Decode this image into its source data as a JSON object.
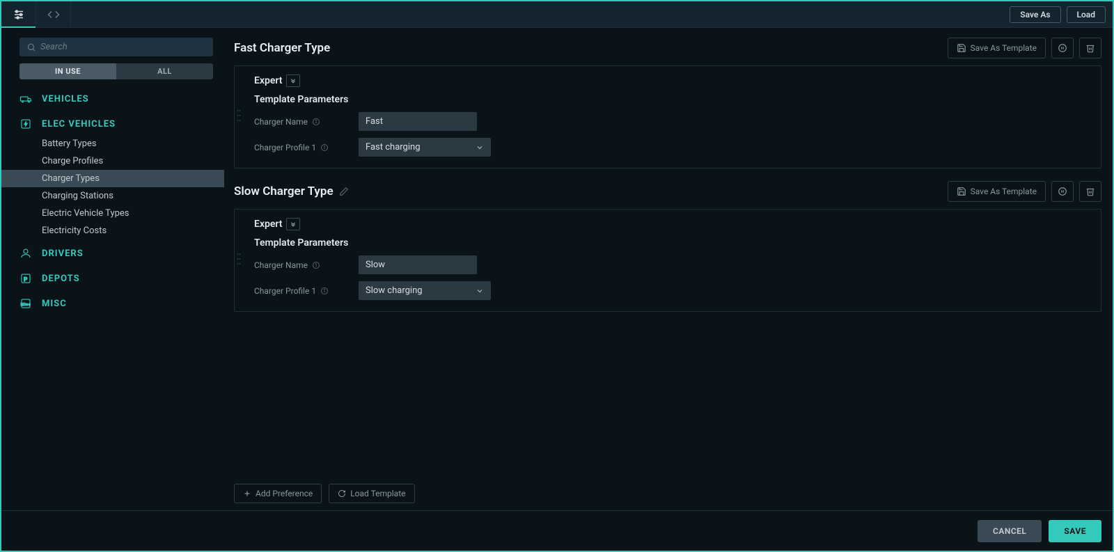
{
  "topbar": {
    "save_as": "Save As",
    "load": "Load"
  },
  "sidebar": {
    "search_placeholder": "Search",
    "filter": {
      "in_use": "IN USE",
      "all": "ALL"
    },
    "sections": [
      {
        "label": "VEHICLES",
        "items": []
      },
      {
        "label": "ELEC VEHICLES",
        "items": [
          {
            "label": "Battery Types"
          },
          {
            "label": "Charge Profiles"
          },
          {
            "label": "Charger Types",
            "active": true
          },
          {
            "label": "Charging Stations"
          },
          {
            "label": "Electric Vehicle Types"
          },
          {
            "label": "Electricity Costs"
          }
        ]
      },
      {
        "label": "DRIVERS",
        "items": []
      },
      {
        "label": "DEPOTS",
        "items": []
      },
      {
        "label": "MISC",
        "items": []
      }
    ]
  },
  "content": {
    "save_as_template": "Save As Template",
    "sections": [
      {
        "title": "Fast Charger Type",
        "editable": false,
        "expert_label": "Expert",
        "subsection": "Template Parameters",
        "params": {
          "name_label": "Charger Name",
          "name_value": "Fast",
          "profile_label": "Charger Profile 1",
          "profile_value": "Fast charging"
        }
      },
      {
        "title": "Slow Charger Type",
        "editable": true,
        "expert_label": "Expert",
        "subsection": "Template Parameters",
        "params": {
          "name_label": "Charger Name",
          "name_value": "Slow",
          "profile_label": "Charger Profile 1",
          "profile_value": "Slow charging"
        }
      }
    ],
    "add_preference": "Add Preference",
    "load_template": "Load Template"
  },
  "footer": {
    "cancel": "CANCEL",
    "save": "SAVE"
  }
}
